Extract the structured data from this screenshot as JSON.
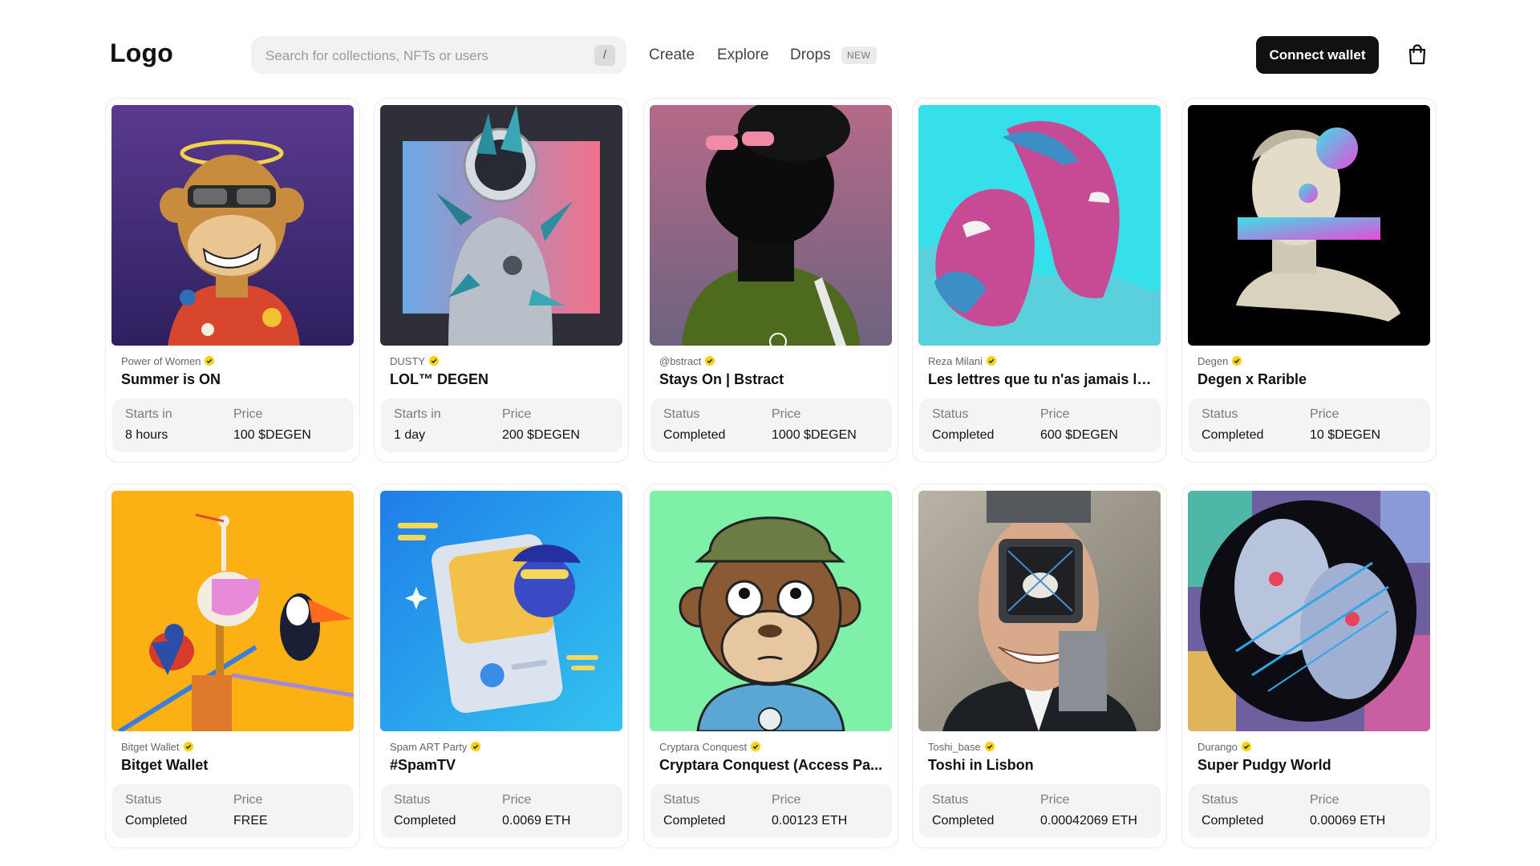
{
  "header": {
    "logo": "Logo",
    "search_placeholder": "Search for collections, NFTs or users",
    "search_shortcut": "/",
    "nav": {
      "create": "Create",
      "explore": "Explore",
      "drops": "Drops",
      "drops_badge": "NEW"
    },
    "connect_label": "Connect wallet"
  },
  "colors": {
    "verified": "#f5d30b",
    "button_bg": "#111111",
    "info_bg": "#f4f4f5"
  },
  "drops": [
    {
      "creator": "Power of Women",
      "title": "Summer is ON",
      "label1": "Starts in",
      "value1": "8 hours",
      "label2": "Price",
      "value2": "100 $DEGEN",
      "art": "ape-with-halo"
    },
    {
      "creator": "DUSTY",
      "title": "LOL™ DEGEN",
      "label1": "Starts in",
      "value1": "1 day",
      "label2": "Price",
      "value2": "200 $DEGEN",
      "art": "crystal-astronaut"
    },
    {
      "creator": "@bstract",
      "title": "Stays On | Bstract",
      "label1": "Status",
      "value1": "Completed",
      "label2": "Price",
      "value2": "1000 $DEGEN",
      "art": "silhouette-pink-glasses"
    },
    {
      "creator": "Reza Milani",
      "title": "Les lettres que tu n'as jamais lu...",
      "label1": "Status",
      "value1": "Completed",
      "label2": "Price",
      "value2": "600 $DEGEN",
      "art": "split-faces-cyan"
    },
    {
      "creator": "Degen",
      "title": "Degen x Rarible",
      "label1": "Status",
      "value1": "Completed",
      "label2": "Price",
      "value2": "10 $DEGEN",
      "art": "marble-bust"
    },
    {
      "creator": "Bitget Wallet",
      "title": "Bitget Wallet",
      "label1": "Status",
      "value1": "Completed",
      "label2": "Price",
      "value2": "FREE",
      "art": "birds-on-yellow"
    },
    {
      "creator": "Spam ART Party",
      "title": "#SpamTV",
      "label1": "Status",
      "value1": "Completed",
      "label2": "Price",
      "value2": "0.0069 ETH",
      "art": "blue-3d-card"
    },
    {
      "creator": "Cryptara Conquest",
      "title": "Cryptara Conquest (Access Pa...",
      "label1": "Status",
      "value1": "Completed",
      "label2": "Price",
      "value2": "0.00123 ETH",
      "art": "cartoon-monkey-cap"
    },
    {
      "creator": "Toshi_base",
      "title": "Toshi in Lisbon",
      "label1": "Status",
      "value1": "Completed",
      "label2": "Price",
      "value2": "0.00042069 ETH",
      "art": "robot-head-man"
    },
    {
      "creator": "Durango",
      "title": "Super Pudgy World",
      "label1": "Status",
      "value1": "Completed",
      "label2": "Price",
      "value2": "0.00069 ETH",
      "art": "collage-faces"
    }
  ]
}
